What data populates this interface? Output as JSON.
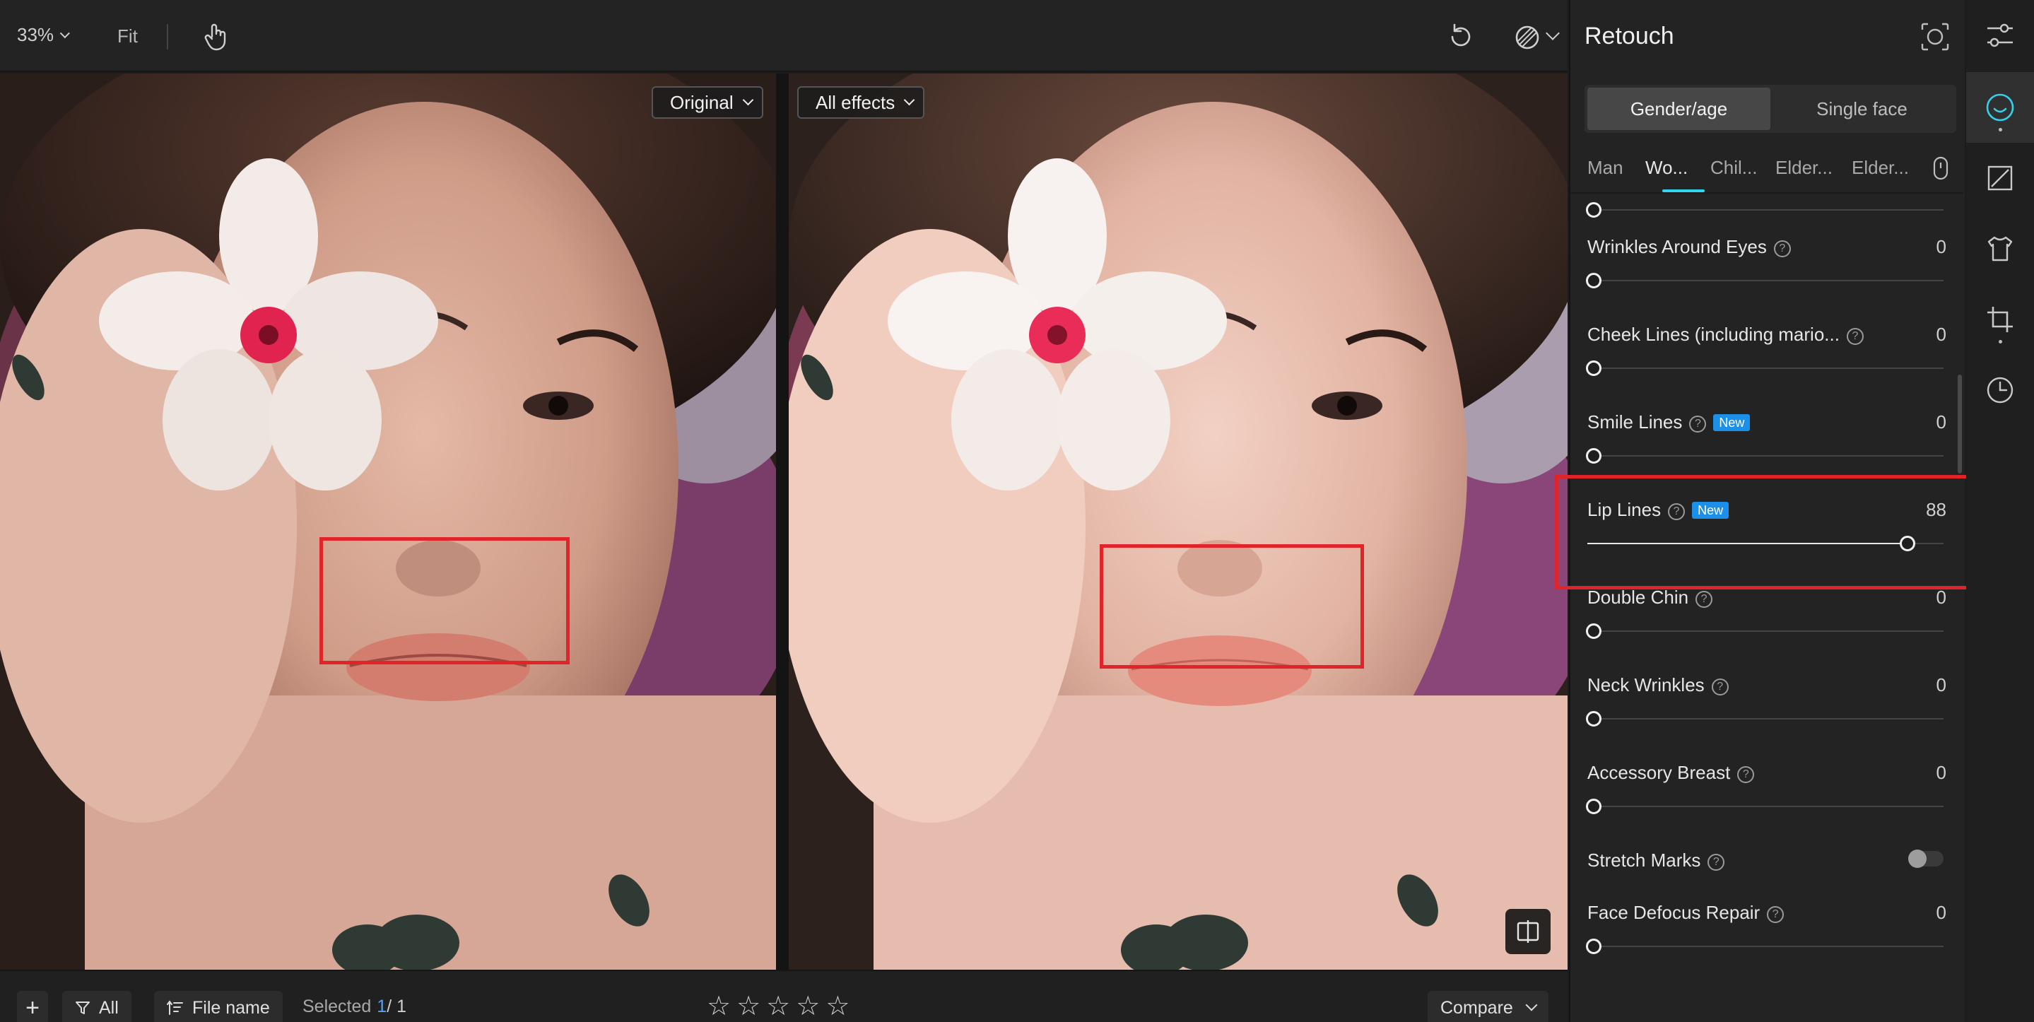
{
  "toolbar": {
    "zoom": "33%",
    "fit": "Fit",
    "icons": [
      "hand-icon",
      "undo-icon",
      "mask-compare-icon"
    ]
  },
  "photos": {
    "left_select": "Original",
    "right_select": "All effects"
  },
  "bottombar": {
    "add": "+",
    "filter_label": "All",
    "sort_label": "File name",
    "selected_label": "Selected",
    "selected_count": "1",
    "selected_total": "/ 1",
    "stars": [
      "☆",
      "☆",
      "☆",
      "☆",
      "☆"
    ],
    "compare_label": "Compare"
  },
  "panel": {
    "title": "Retouch",
    "segments": [
      "Gender/age",
      "Single face"
    ],
    "active_segment": 0,
    "subtabs": [
      "Man",
      "Wo...",
      "Chil...",
      "Elder...",
      "Elder..."
    ],
    "active_subtab": 1,
    "help_glyph": "?",
    "new_badge": "New",
    "rows": [
      {
        "label": "Wrinkles Around Eyes",
        "value": "0",
        "level": 0,
        "help": true,
        "new": false
      },
      {
        "label": "Cheek Lines (including mario...",
        "value": "0",
        "level": 0,
        "help": true,
        "new": false
      },
      {
        "label": "Smile Lines",
        "value": "0",
        "level": 0,
        "help": true,
        "new": true
      },
      {
        "label": "Lip Lines",
        "value": "88",
        "level": 0.88,
        "help": true,
        "new": true
      },
      {
        "label": "Double Chin",
        "value": "0",
        "level": 0,
        "help": true,
        "new": false
      },
      {
        "label": "Neck Wrinkles",
        "value": "0",
        "level": 0,
        "help": true,
        "new": false
      },
      {
        "label": "Accessory Breast",
        "value": "0",
        "level": 0,
        "help": true,
        "new": false
      },
      {
        "label": "Stretch Marks",
        "toggle": false,
        "help": true,
        "new": false
      },
      {
        "label": "Face Defocus Repair",
        "value": "0",
        "level": 0,
        "help": true,
        "new": false
      }
    ]
  },
  "rail": {
    "items": [
      "adjust-sliders-icon",
      "face-retouch-icon",
      "edit-icon",
      "clothing-icon",
      "crop-icon",
      "history-icon"
    ],
    "active": 1
  },
  "colors": {
    "accent": "#2fd6ee",
    "badge": "#1c8fe8",
    "highlight": "#e1242a",
    "count": "#4fa3ff"
  }
}
